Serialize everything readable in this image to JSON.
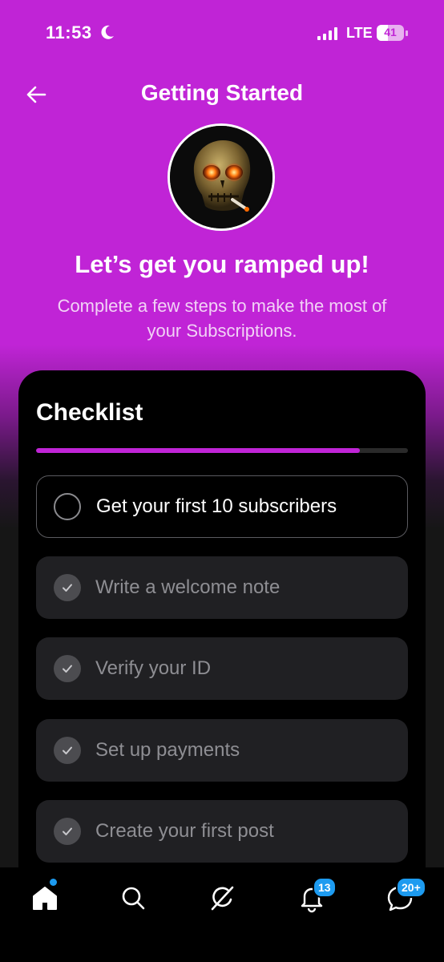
{
  "status_bar": {
    "time": "11:53",
    "network": "LTE",
    "battery_level": "41"
  },
  "header": {
    "title": "Getting Started",
    "back_icon": "arrow-left-icon"
  },
  "intro": {
    "headline": "Let’s get you ramped up!",
    "subtitle": "Complete a few steps to make the most of your Subscriptions."
  },
  "checklist": {
    "title": "Checklist",
    "progress_fraction": 0.87,
    "items": [
      {
        "label": "Get your first 10 subscribers",
        "completed": false
      },
      {
        "label": "Write a welcome note",
        "completed": true
      },
      {
        "label": "Verify your ID",
        "completed": true
      },
      {
        "label": "Set up payments",
        "completed": true
      },
      {
        "label": "Create your first post",
        "completed": true
      }
    ]
  },
  "bottom_nav": {
    "items": [
      {
        "icon": "home-icon"
      },
      {
        "icon": "search-icon"
      },
      {
        "icon": "grok-icon"
      },
      {
        "icon": "bell-icon",
        "badge": "13"
      },
      {
        "icon": "messages-icon",
        "badge": "20+"
      }
    ]
  },
  "colors": {
    "accent": "#c024d6",
    "badge": "#1d9bf0",
    "card": "#000000",
    "item_bg": "#202023"
  }
}
